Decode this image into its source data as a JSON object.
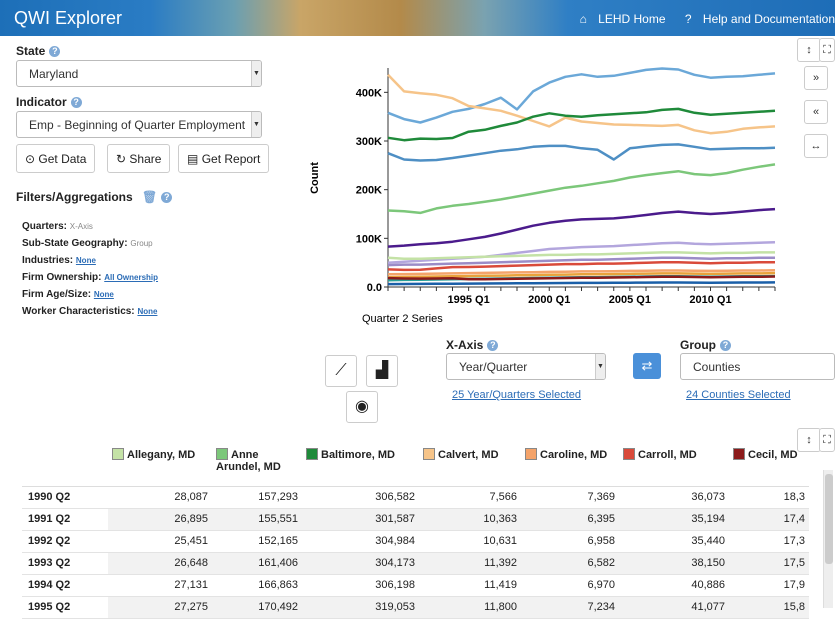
{
  "header": {
    "title": "QWI Explorer",
    "links": [
      "LEHD Home",
      "Help and Documentation"
    ]
  },
  "state": {
    "label": "State",
    "value": "Maryland"
  },
  "indicator": {
    "label": "Indicator",
    "value": "Emp - Beginning of Quarter Employment"
  },
  "buttons": {
    "get_data": "Get Data",
    "share": "Share",
    "get_report": "Get Report"
  },
  "filters": {
    "title": "Filters/Aggregations",
    "quarters_label": "Quarters:",
    "quarters_value": "X-Axis",
    "geo_label": "Sub-State Geography:",
    "geo_value": "Group",
    "industries_label": "Industries:",
    "industries_value": "None",
    "ownership_label": "Firm Ownership:",
    "ownership_value": "All Ownership",
    "agesize_label": "Firm Age/Size:",
    "agesize_value": "None",
    "worker_label": "Worker Characteristics:",
    "worker_value": "None"
  },
  "xaxis": {
    "label": "X-Axis",
    "value": "Year/Quarter",
    "link": "25 Year/Quarters Selected"
  },
  "group": {
    "label": "Group",
    "value": "Counties",
    "link": "24 Counties Selected"
  },
  "chart_data": {
    "type": "line",
    "ylabel": "Count",
    "xlabel": "Quarter 2 Series",
    "yticks": [
      "0.0",
      "100K",
      "200K",
      "300K",
      "400K"
    ],
    "xticks": [
      "1995 Q1",
      "2000 Q1",
      "2005 Q1",
      "2010 Q1"
    ],
    "ylim": [
      0,
      450000
    ],
    "x": [
      1990,
      1991,
      1992,
      1993,
      1994,
      1995,
      1996,
      1997,
      1998,
      1999,
      2000,
      2001,
      2002,
      2003,
      2004,
      2005,
      2006,
      2007,
      2008,
      2009,
      2010,
      2011,
      2012,
      2013,
      2014
    ],
    "series": [
      {
        "color": "#6ba8d8",
        "values": [
          358000,
          345000,
          338000,
          348000,
          360000,
          366000,
          376000,
          389000,
          365000,
          402000,
          420000,
          432000,
          437000,
          432000,
          434000,
          440000,
          446000,
          449000,
          447000,
          436000,
          430000,
          432000,
          433000,
          436000,
          439000
        ]
      },
      {
        "color": "#f6c489",
        "values": [
          436000,
          402000,
          398000,
          395000,
          388000,
          372000,
          367000,
          362000,
          352000,
          341000,
          330000,
          348000,
          340000,
          337000,
          334000,
          333000,
          332000,
          331000,
          333000,
          322000,
          316000,
          319000,
          325000,
          328000,
          330000
        ]
      },
      {
        "color": "#1f8a3a",
        "values": [
          306582,
          301587,
          304984,
          304173,
          306198,
          319053,
          323000,
          331000,
          338000,
          350000,
          357000,
          352000,
          350000,
          353000,
          355000,
          357000,
          359000,
          364000,
          366000,
          358000,
          354000,
          356000,
          358000,
          360000,
          362000
        ]
      },
      {
        "color": "#4e8fc4",
        "values": [
          275000,
          262000,
          260000,
          261000,
          265000,
          270000,
          275000,
          280000,
          283000,
          288000,
          290000,
          290000,
          285000,
          282000,
          262000,
          285000,
          289000,
          292000,
          293000,
          288000,
          283000,
          284000,
          285000,
          285000,
          286000
        ]
      },
      {
        "color": "#7cc77a",
        "values": [
          157293,
          155551,
          152165,
          161406,
          166863,
          170492,
          175000,
          180000,
          186000,
          192000,
          198000,
          204000,
          208000,
          213000,
          218000,
          225000,
          230000,
          234000,
          238000,
          232000,
          230000,
          234000,
          241000,
          247000,
          252000
        ]
      },
      {
        "color": "#4b1b8c",
        "values": [
          83000,
          85000,
          88000,
          90000,
          93000,
          98000,
          103000,
          110000,
          118000,
          126000,
          132000,
          136000,
          139000,
          140000,
          141000,
          144000,
          148000,
          152000,
          155000,
          152000,
          150000,
          152000,
          155000,
          158000,
          160000
        ]
      },
      {
        "color": "#b3a6dd",
        "values": [
          50000,
          52000,
          54000,
          56000,
          58000,
          60000,
          62000,
          66000,
          70000,
          74000,
          78000,
          80000,
          82000,
          83000,
          84000,
          86000,
          88000,
          90000,
          91000,
          89000,
          88000,
          89000,
          90000,
          91000,
          92000
        ]
      },
      {
        "color": "#c4e2a6",
        "values": [
          60000,
          58000,
          58000,
          59000,
          60000,
          61000,
          62000,
          63000,
          64000,
          65000,
          66000,
          66000,
          67000,
          67000,
          68000,
          69000,
          70000,
          71000,
          71000,
          70000,
          69000,
          70000,
          70000,
          71000,
          71000
        ]
      },
      {
        "color": "#d94a3a",
        "values": [
          36073,
          35194,
          35440,
          38150,
          40886,
          41077,
          42000,
          43000,
          44000,
          45000,
          46000,
          47000,
          47000,
          48000,
          48000,
          49000,
          50000,
          51000,
          51000,
          50000,
          49000,
          50000,
          50000,
          51000,
          51000
        ]
      },
      {
        "color": "#9b8cc7",
        "values": [
          45000,
          46000,
          46000,
          47000,
          48000,
          49000,
          50000,
          51000,
          52000,
          53000,
          54000,
          55000,
          56000,
          56000,
          57000,
          58000,
          59000,
          60000,
          60000,
          59000,
          58000,
          59000,
          59000,
          60000,
          60000
        ]
      },
      {
        "color": "#f4a36a",
        "values": [
          26000,
          26500,
          27000,
          27500,
          28000,
          28500,
          29000,
          29500,
          30000,
          30500,
          31000,
          31500,
          32000,
          32000,
          32500,
          33000,
          33500,
          34000,
          34000,
          33500,
          33000,
          33500,
          34000,
          34000,
          34500
        ]
      },
      {
        "color": "#e9a23b",
        "values": [
          20000,
          20500,
          21000,
          21500,
          22000,
          22500,
          23000,
          23500,
          24000,
          24500,
          25000,
          25500,
          26000,
          26000,
          26500,
          27000,
          27500,
          28000,
          28000,
          27500,
          27000,
          27500,
          28000,
          28000,
          28500
        ]
      },
      {
        "color": "#2aa198",
        "values": [
          14000,
          14500,
          15000,
          15500,
          16000,
          16500,
          17000,
          17500,
          18000,
          18500,
          19000,
          19500,
          20000,
          20000,
          20500,
          21000,
          21500,
          22000,
          22000,
          21500,
          21000,
          21500,
          22000,
          22000,
          22500
        ]
      },
      {
        "color": "#1a5fa8",
        "values": [
          6000,
          6200,
          6400,
          6600,
          6800,
          7000,
          7200,
          7400,
          7600,
          7800,
          8000,
          8200,
          8400,
          8400,
          8600,
          8800,
          9000,
          9200,
          9200,
          9000,
          8800,
          9000,
          9200,
          9200,
          9400
        ]
      },
      {
        "color": "#8b1a1a",
        "values": [
          18300,
          17400,
          17300,
          17500,
          17900,
          15800,
          16000,
          16500,
          17000,
          17500,
          18000,
          18500,
          19000,
          19000,
          19500,
          20000,
          20500,
          21000,
          21000,
          20500,
          20000,
          20500,
          21000,
          21000,
          21500
        ]
      }
    ]
  },
  "table": {
    "columns": [
      {
        "name": "Allegany, MD",
        "color": "#c4e2a6"
      },
      {
        "name": "Anne Arundel, MD",
        "color": "#7cc77a"
      },
      {
        "name": "Baltimore, MD",
        "color": "#1f8a3a"
      },
      {
        "name": "Calvert, MD",
        "color": "#f6c489"
      },
      {
        "name": "Caroline, MD",
        "color": "#f4a36a"
      },
      {
        "name": "Carroll, MD",
        "color": "#d94a3a"
      },
      {
        "name": "Cecil, MD",
        "color": "#8b1a1a"
      }
    ],
    "rows": [
      {
        "label": "1990 Q2",
        "cells": [
          "28,087",
          "157,293",
          "306,582",
          "7,566",
          "7,369",
          "36,073",
          "18,3"
        ]
      },
      {
        "label": "1991 Q2",
        "cells": [
          "26,895",
          "155,551",
          "301,587",
          "10,363",
          "6,395",
          "35,194",
          "17,4"
        ]
      },
      {
        "label": "1992 Q2",
        "cells": [
          "25,451",
          "152,165",
          "304,984",
          "10,631",
          "6,958",
          "35,440",
          "17,3"
        ]
      },
      {
        "label": "1993 Q2",
        "cells": [
          "26,648",
          "161,406",
          "304,173",
          "11,392",
          "6,582",
          "38,150",
          "17,5"
        ]
      },
      {
        "label": "1994 Q2",
        "cells": [
          "27,131",
          "166,863",
          "306,198",
          "11,419",
          "6,970",
          "40,886",
          "17,9"
        ]
      },
      {
        "label": "1995 Q2",
        "cells": [
          "27,275",
          "170,492",
          "319,053",
          "11,800",
          "7,234",
          "41,077",
          "15,8"
        ]
      }
    ]
  }
}
